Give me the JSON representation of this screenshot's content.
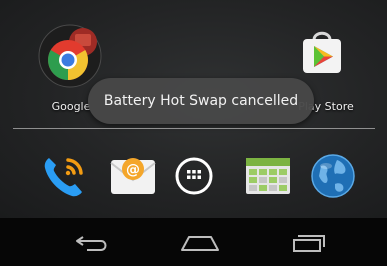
{
  "home_screen": {
    "apps": [
      {
        "label": "Google",
        "icon": "google-chrome-folder-icon"
      },
      {
        "label": "Play Store",
        "icon": "play-store-icon"
      }
    ]
  },
  "toast": {
    "message": "Battery Hot Swap cancelled"
  },
  "dock": {
    "items": [
      {
        "icon": "phone-icon"
      },
      {
        "icon": "email-icon"
      },
      {
        "icon": "app-drawer-icon"
      },
      {
        "icon": "calendar-grid-icon"
      },
      {
        "icon": "browser-globe-icon"
      }
    ]
  },
  "navigation_bar": {
    "buttons": [
      {
        "icon": "back-icon"
      },
      {
        "icon": "home-icon"
      },
      {
        "icon": "recent-apps-icon"
      }
    ]
  },
  "colors": {
    "wallpaper": "#262728",
    "toast_background": "#484848",
    "navbar_background": "#060606",
    "label_text": "#f0f0f0"
  }
}
